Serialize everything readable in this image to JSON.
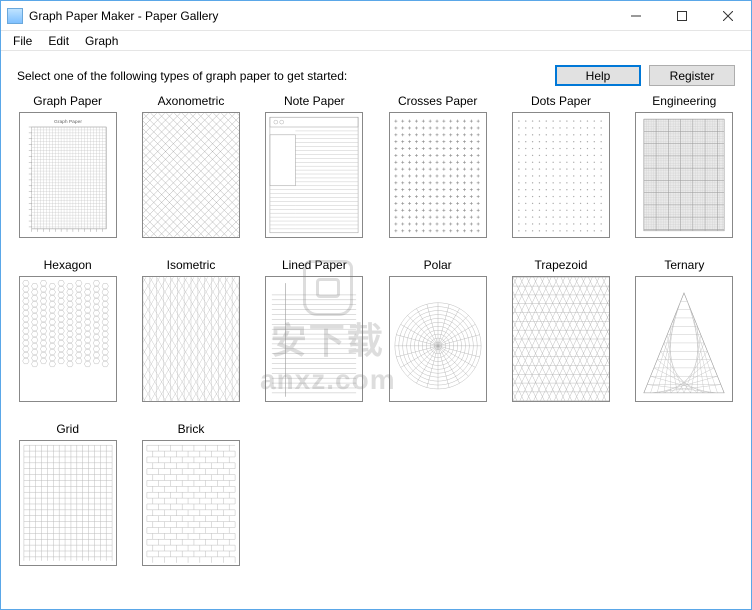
{
  "window": {
    "title": "Graph Paper Maker - Paper Gallery"
  },
  "menu": {
    "file": "File",
    "edit": "Edit",
    "graph": "Graph"
  },
  "instruction": "Select one of the following types of graph paper to get started:",
  "buttons": {
    "help": "Help",
    "register": "Register"
  },
  "tiles": [
    {
      "label": "Graph Paper",
      "kind": "graphpaper"
    },
    {
      "label": "Axonometric",
      "kind": "axonometric"
    },
    {
      "label": "Note Paper",
      "kind": "notepaper"
    },
    {
      "label": "Crosses Paper",
      "kind": "crosses"
    },
    {
      "label": "Dots Paper",
      "kind": "dots"
    },
    {
      "label": "Engineering",
      "kind": "engineering"
    },
    {
      "label": "Hexagon",
      "kind": "hexagon"
    },
    {
      "label": "Isometric",
      "kind": "isometric"
    },
    {
      "label": "Lined Paper",
      "kind": "lined"
    },
    {
      "label": "Polar",
      "kind": "polar"
    },
    {
      "label": "Trapezoid",
      "kind": "trapezoid"
    },
    {
      "label": "Ternary",
      "kind": "ternary"
    },
    {
      "label": "Grid",
      "kind": "grid"
    },
    {
      "label": "Brick",
      "kind": "brick"
    }
  ],
  "watermark": {
    "cn": "安下载",
    "en": "anxz.com"
  }
}
